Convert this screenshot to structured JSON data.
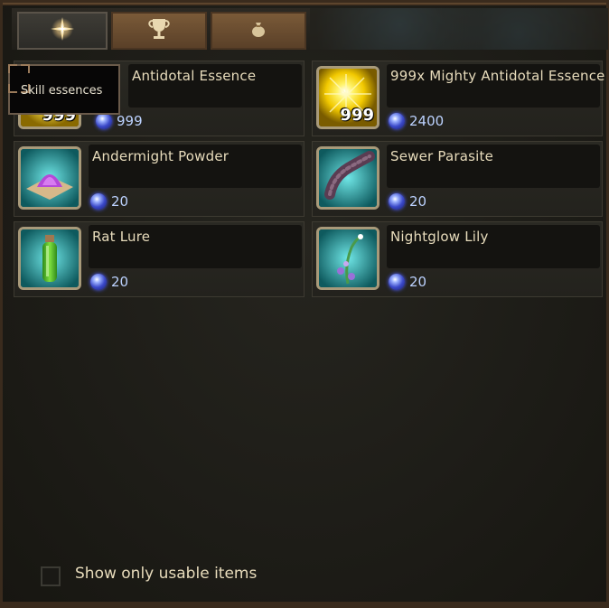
{
  "tabs": [
    {
      "name": "skill-essences",
      "icon": "sparkle-icon"
    },
    {
      "name": "trophies",
      "icon": "trophy-icon"
    },
    {
      "name": "loot-bag",
      "icon": "money-bag-icon"
    }
  ],
  "tooltip": {
    "text": "Skill  essences"
  },
  "items": [
    {
      "name": "Antidotal  Essence",
      "price": "999",
      "count": "999",
      "icon": "antidotal-essence-icon"
    },
    {
      "name": "999x  Mighty  Antidotal  Essence",
      "price": "2400",
      "count": "999",
      "icon": "mighty-antidotal-essence-icon"
    },
    {
      "name": "Andermight  Powder",
      "price": "20",
      "icon": "andermight-powder-icon"
    },
    {
      "name": "Sewer  Parasite",
      "price": "20",
      "icon": "sewer-parasite-icon"
    },
    {
      "name": "Rat  Lure",
      "price": "20",
      "icon": "rat-lure-icon"
    },
    {
      "name": "Nightglow  Lily",
      "price": "20",
      "icon": "nightglow-lily-icon"
    }
  ],
  "footer": {
    "filter_label": "Show  only  usable  items",
    "checked": false
  },
  "colors": {
    "item_text": "#e8dcbc",
    "price_text": "#bcd2ff",
    "tab_brown": "#7a5a38"
  }
}
